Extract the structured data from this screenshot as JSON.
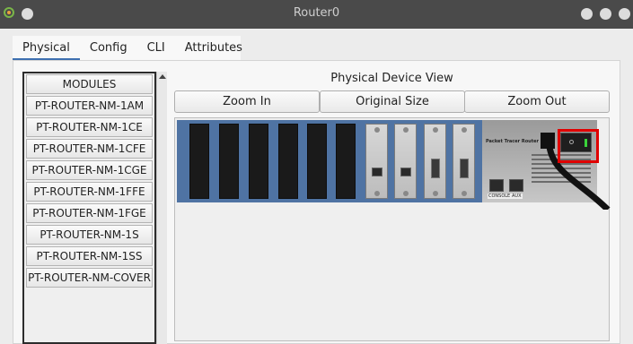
{
  "window": {
    "title": "Router0"
  },
  "tabs": [
    {
      "label": "Physical",
      "active": true
    },
    {
      "label": "Config",
      "active": false
    },
    {
      "label": "CLI",
      "active": false
    },
    {
      "label": "Attributes",
      "active": false
    }
  ],
  "modules": {
    "header": "MODULES",
    "items": [
      "PT-ROUTER-NM-1AM",
      "PT-ROUTER-NM-1CE",
      "PT-ROUTER-NM-1CFE",
      "PT-ROUTER-NM-1CGE",
      "PT-ROUTER-NM-1FFE",
      "PT-ROUTER-NM-1FGE",
      "PT-ROUTER-NM-1S",
      "PT-ROUTER-NM-1SS",
      "PT-ROUTER-NM-COVER"
    ]
  },
  "device_view": {
    "title": "Physical Device View",
    "zoom_in": "Zoom In",
    "original_size": "Original Size",
    "zoom_out": "Zoom Out"
  },
  "router": {
    "brand": "Packet Tracer Router",
    "console_label": "CONSOLE",
    "aux_label": "AUX",
    "power_switch_highlight_color": "#e00000",
    "chassis_color": "#4f73a3",
    "led_color": "#3ad43a"
  }
}
